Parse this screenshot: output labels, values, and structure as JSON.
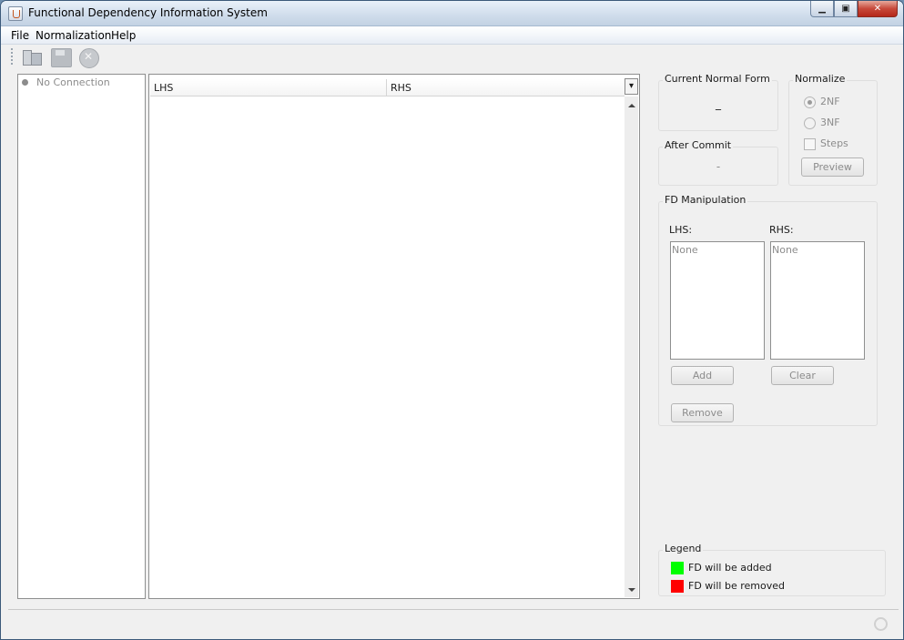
{
  "window": {
    "title": "Functional Dependency Information System"
  },
  "menu": {
    "file": "File",
    "normalization": "Normalization",
    "help": "Help"
  },
  "toolbar": {
    "icons": [
      "connect-icon",
      "save-icon",
      "stop-icon"
    ]
  },
  "tree": {
    "status": "No Connection"
  },
  "table": {
    "columns": [
      "LHS",
      "RHS"
    ]
  },
  "current_normal_form": {
    "title": "Current Normal Form",
    "value": "_"
  },
  "after_commit": {
    "title": "After Commit",
    "value": "-"
  },
  "normalize": {
    "title": "Normalize",
    "options": [
      "2NF",
      "3NF"
    ],
    "selected": "2NF",
    "steps_label": "Steps",
    "preview_label": "Preview"
  },
  "fd_manipulation": {
    "title": "FD Manipulation",
    "lhs_label": "LHS:",
    "rhs_label": "RHS:",
    "lhs_value": "None",
    "rhs_value": "None",
    "add_label": "Add",
    "clear_label": "Clear",
    "remove_label": "Remove"
  },
  "legend": {
    "title": "Legend",
    "items": [
      {
        "label": "FD will be added",
        "color": "#00ff00"
      },
      {
        "label": "FD will be removed",
        "color": "#ff0000"
      }
    ]
  }
}
